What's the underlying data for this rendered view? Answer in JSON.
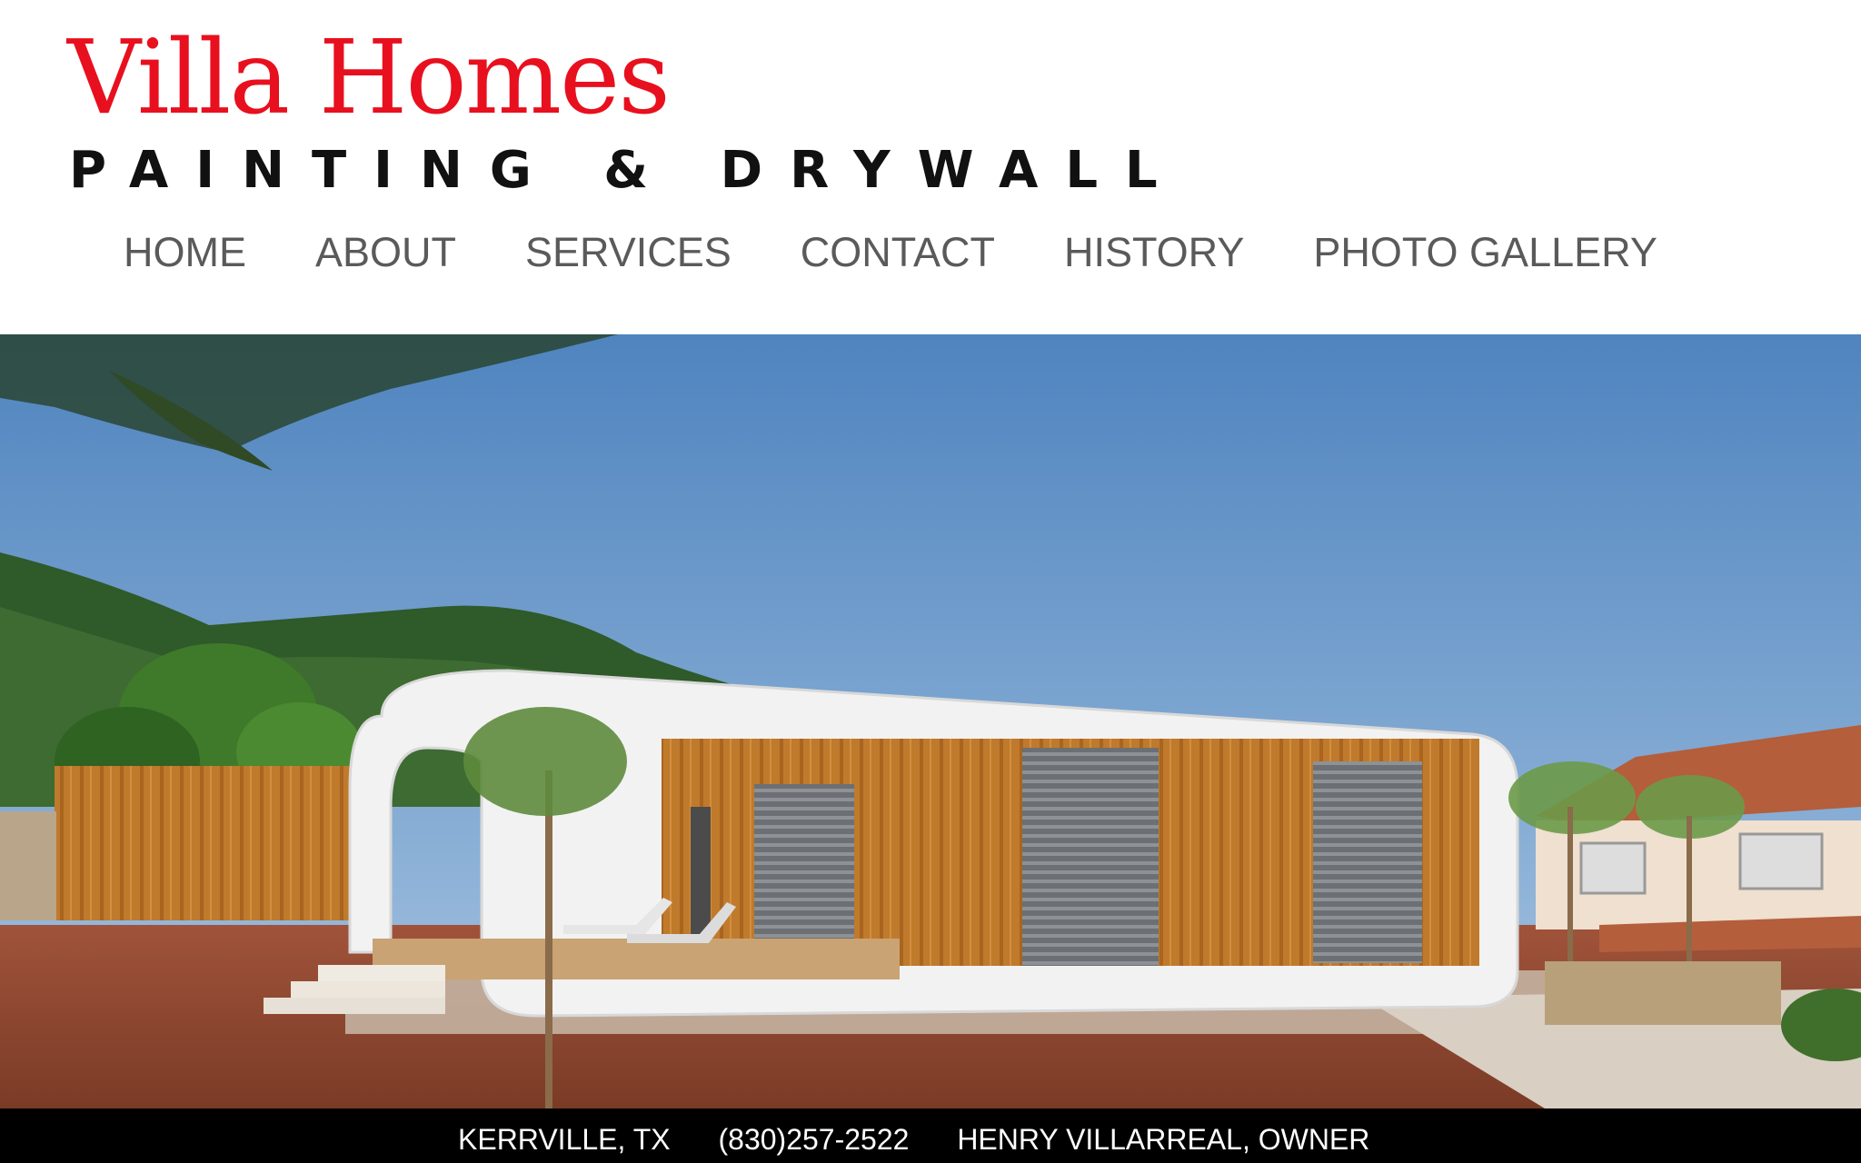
{
  "brand": {
    "title": "Villa Homes",
    "subtitle": "PAINTING & DRYWALL",
    "title_color": "#e8101e"
  },
  "nav": {
    "items": [
      {
        "label": "HOME"
      },
      {
        "label": "ABOUT"
      },
      {
        "label": "SERVICES"
      },
      {
        "label": "CONTACT"
      },
      {
        "label": "HISTORY"
      },
      {
        "label": "PHOTO GALLERY"
      }
    ]
  },
  "hero": {
    "image": "modern-house-photo"
  },
  "footer": {
    "location": "KERRVILLE, TX",
    "phone": "(830)257-2522",
    "owner": "HENRY VILLARREAL, OWNER"
  }
}
